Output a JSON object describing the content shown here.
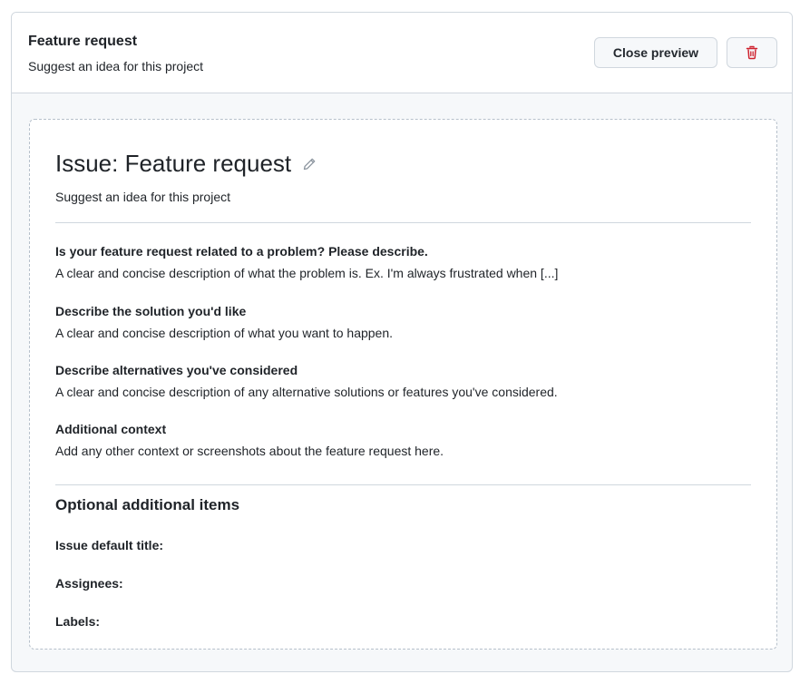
{
  "header": {
    "title": "Feature request",
    "subtitle": "Suggest an idea for this project",
    "close_preview_label": "Close preview",
    "delete_icon": "trash-icon"
  },
  "preview": {
    "title": "Issue: Feature request",
    "edit_icon": "pencil-icon",
    "subtitle": "Suggest an idea for this project",
    "sections": [
      {
        "heading": "Is your feature request related to a problem? Please describe.",
        "body": "A clear and concise description of what the problem is. Ex. I'm always frustrated when [...]"
      },
      {
        "heading": "Describe the solution you'd like",
        "body": "A clear and concise description of what you want to happen."
      },
      {
        "heading": "Describe alternatives you've considered",
        "body": "A clear and concise description of any alternative solutions or features you've considered."
      },
      {
        "heading": "Additional context",
        "body": "Add any other context or screenshots about the feature request here."
      }
    ],
    "optional": {
      "title": "Optional additional items",
      "default_title_label": "Issue default title:",
      "assignees_label": "Assignees:",
      "labels_label": "Labels:"
    }
  },
  "colors": {
    "border": "#d0d7de",
    "danger": "#cf222e",
    "background": "#f6f8fa"
  }
}
